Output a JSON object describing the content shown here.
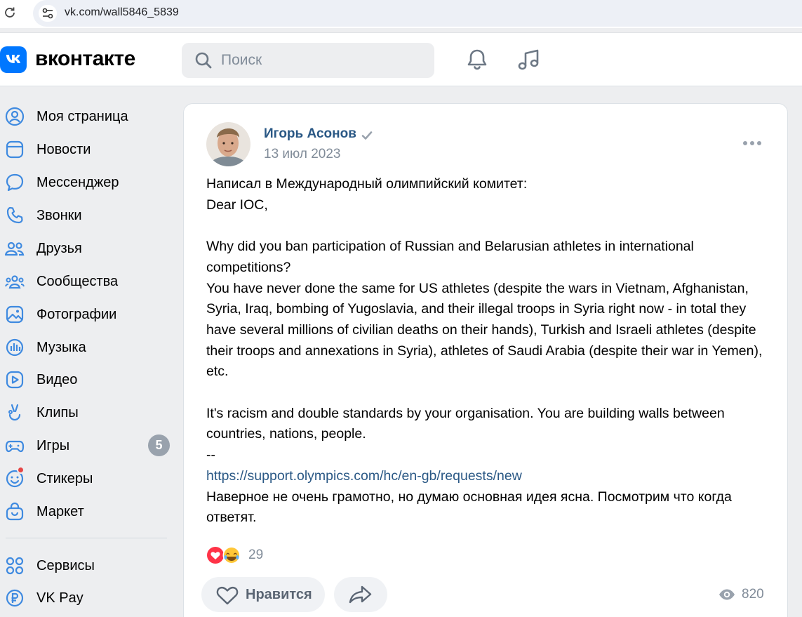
{
  "browser": {
    "url": "vk.com/wall5846_5839"
  },
  "header": {
    "logo_text": "вконтакте",
    "search_placeholder": "Поиск"
  },
  "sidebar": {
    "items": [
      {
        "label": "Моя страница",
        "icon": "user-circle-icon"
      },
      {
        "label": "Новости",
        "icon": "news-icon"
      },
      {
        "label": "Мессенджер",
        "icon": "message-icon"
      },
      {
        "label": "Звонки",
        "icon": "phone-icon"
      },
      {
        "label": "Друзья",
        "icon": "friends-icon"
      },
      {
        "label": "Сообщества",
        "icon": "communities-icon"
      },
      {
        "label": "Фотографии",
        "icon": "photos-icon"
      },
      {
        "label": "Музыка",
        "icon": "music-icon"
      },
      {
        "label": "Видео",
        "icon": "video-icon"
      },
      {
        "label": "Клипы",
        "icon": "clips-icon"
      },
      {
        "label": "Игры",
        "icon": "gamepad-icon",
        "badge": "5"
      },
      {
        "label": "Стикеры",
        "icon": "sticker-icon"
      },
      {
        "label": "Маркет",
        "icon": "market-icon"
      },
      {
        "label": "Сервисы",
        "icon": "services-icon"
      },
      {
        "label": "VK Pay",
        "icon": "ruble-icon"
      }
    ]
  },
  "post": {
    "author": "Игорь Асонов",
    "date": "13 июл 2023",
    "lines": [
      "Написал в Международный олимпийский комитет:",
      "Dear IOC,",
      "",
      "Why did you ban participation of Russian and Belarusian athletes in international competitions?",
      "You have never done the same for US athletes (despite the wars in Vietnam, Afghanistan, Syria, Iraq, bombing of Yugoslavia, and their illegal troops in Syria right now - in total they have several millions of civilian deaths on their hands), Turkish and Israeli athletes (despite their troops and annexations in Syria), athletes of Saudi Arabia (despite their war in Yemen), etc.",
      "",
      "It's racism and double standards by your organisation. You are building walls between countries, nations, people.",
      "--"
    ],
    "link": "https://support.olympics.com/hc/en-gb/requests/new",
    "closing": "Наверное не очень грамотно, но думаю основная идея ясна. Посмотрим что когда ответят.",
    "reactions_count": "29",
    "like_label": "Нравится",
    "views": "820"
  },
  "colors": {
    "accent": "#0077ff",
    "link": "#2a5885",
    "secondary_text": "#818c99",
    "badge": "#99a2ad",
    "notify_dot": "#e64646"
  }
}
